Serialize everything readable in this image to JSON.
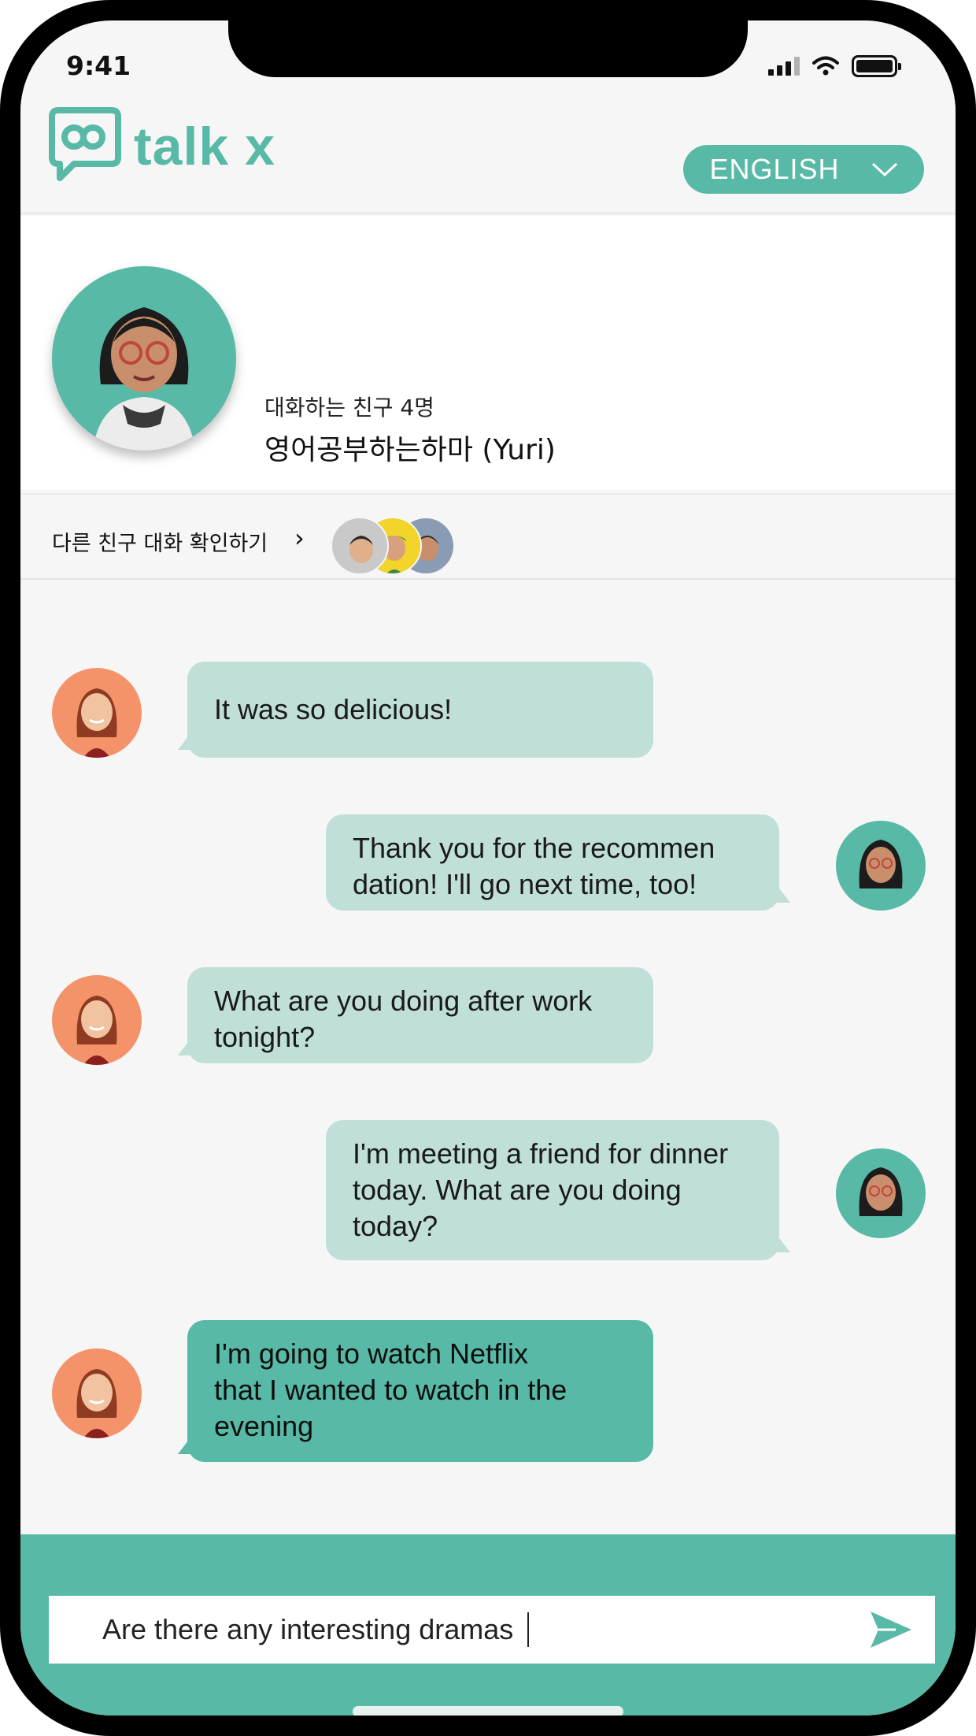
{
  "status_bar": {
    "time": "9:41"
  },
  "header": {
    "logo_text": "talk x",
    "language_label": "ENGLISH"
  },
  "profile": {
    "subtitle": "대화하는 친구 4명",
    "name": "영어공부하는하마 (Yuri)"
  },
  "friends": {
    "label": "다른 친구 대화 확인하기",
    "chevron": "›"
  },
  "messages": [
    {
      "side": "left",
      "text": "It was so delicious!"
    },
    {
      "side": "right",
      "text": "Thank you for the recommen\ndation! I'll go next time, too!"
    },
    {
      "side": "left",
      "text": "What are you doing after work\ntonight?"
    },
    {
      "side": "right",
      "text": "I'm meeting a friend for dinner\ntoday. What are you doing\ntoday?"
    },
    {
      "side": "left",
      "text": "I'm going to watch Netflix\nthat I wanted to watch in the\nevening"
    }
  ],
  "composer": {
    "value": "Are there any interesting dramas"
  },
  "colors": {
    "accent": "#58b9a6",
    "bubble": "#bfdfd8",
    "avatar_orange": "#f4936a"
  }
}
